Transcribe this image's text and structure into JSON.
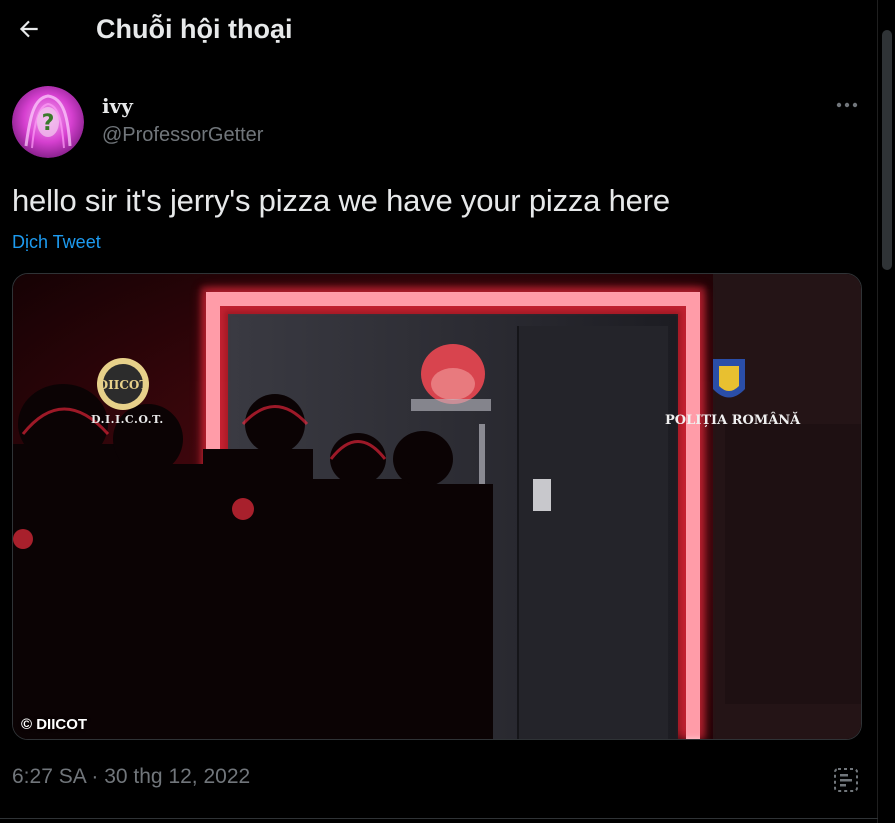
{
  "header": {
    "title": "Chuỗi hội thoại",
    "back_icon": "arrow-left-icon"
  },
  "tweet": {
    "author": {
      "display_name": "ivy",
      "handle": "@ProfessorGetter",
      "avatar_icon": "question-mark-avatar"
    },
    "text": "hello sir it's jerry's pizza we have your pizza here",
    "translate_label": "Dịch Tweet",
    "media": {
      "left_logo_label": "D.I.I.C.O.T.",
      "right_logo_label": "POLIȚIA ROMÂNĂ",
      "credit": "© DIICOT"
    },
    "timestamp": "6:27 SA · 30 thg 12, 2022"
  },
  "colors": {
    "background": "#000000",
    "text_primary": "#e7e9ea",
    "text_secondary": "#71767b",
    "link": "#1d9bf0",
    "border": "#2f3336"
  }
}
